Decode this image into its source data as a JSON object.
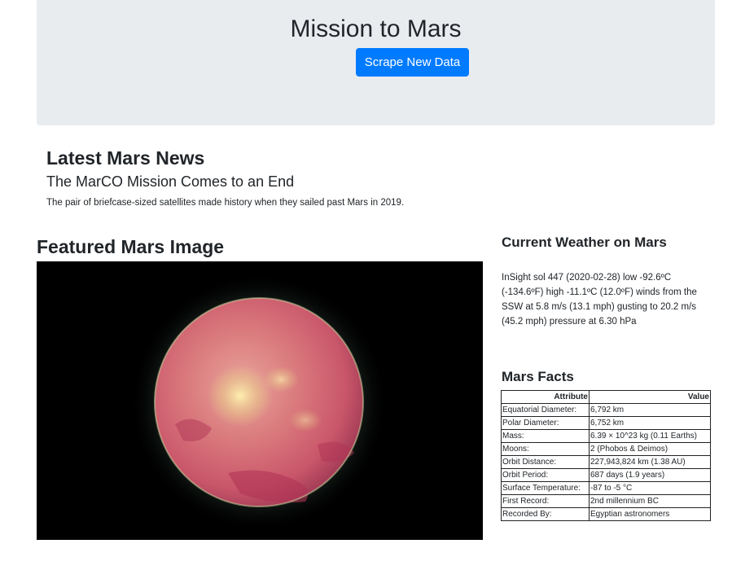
{
  "header": {
    "title": "Mission to Mars",
    "scrape_button": "Scrape New Data"
  },
  "news": {
    "section_title": "Latest Mars News",
    "headline": "The MarCO Mission Comes to an End",
    "teaser": "The pair of briefcase-sized satellites made history when they sailed past Mars in 2019."
  },
  "featured": {
    "section_title": "Featured Mars Image"
  },
  "weather": {
    "section_title": "Current Weather on Mars",
    "text": "InSight sol 447 (2020-02-28) low -92.6ºC (-134.6ºF) high -11.1ºC (12.0ºF) winds from the SSW at 5.8 m/s (13.1 mph) gusting to 20.2 m/s (45.2 mph) pressure at 6.30 hPa"
  },
  "facts": {
    "section_title": "Mars Facts",
    "headers": [
      "Attribute",
      "Value"
    ],
    "rows": [
      [
        "Equatorial Diameter:",
        "6,792 km"
      ],
      [
        "Polar Diameter:",
        "6,752 km"
      ],
      [
        "Mass:",
        "6.39 × 10^23 kg (0.11 Earths)"
      ],
      [
        "Moons:",
        "2 (Phobos & Deimos)"
      ],
      [
        "Orbit Distance:",
        "227,943,824 km (1.38 AU)"
      ],
      [
        "Orbit Period:",
        "687 days (1.9 years)"
      ],
      [
        "Surface Temperature:",
        "-87 to -5 °C"
      ],
      [
        "First Record:",
        "2nd millennium BC"
      ],
      [
        "Recorded By:",
        "Egyptian astronomers"
      ]
    ]
  }
}
